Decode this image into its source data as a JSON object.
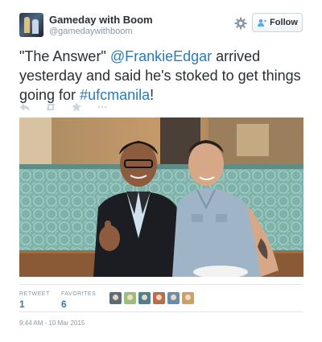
{
  "header": {
    "display_name": "Gameday with Boom",
    "handle": "@gamedaywithboom",
    "follow_label": "Follow",
    "settings_icon": "gear-icon",
    "follow_icon": "add-user-icon"
  },
  "tweet": {
    "text_before": "\"The Answer\" ",
    "mention": "@FrankieEdgar",
    "text_middle": " arrived yesterday and said he's stoked to get things going for ",
    "hashtag": "#ufcmanila",
    "text_after": "!"
  },
  "actions": {
    "reply_icon": "reply-icon",
    "retweet_icon": "retweet-icon",
    "favorite_icon": "star-icon"
  },
  "stats": {
    "retweets_label": "RETWEET",
    "retweets_value": "1",
    "favorites_label": "FAVORITES",
    "favorites_value": "6",
    "favoriter_colors": [
      "#5b6b7a",
      "#9bbd7e",
      "#4d7f8f",
      "#b86d4b",
      "#6b8cae",
      "#c9a26b"
    ]
  },
  "timestamp": "9:44 AM - 10 Mar 2015",
  "colors": {
    "link": "#2b7bb9",
    "text": "#292f33",
    "muted": "#8899a6"
  }
}
